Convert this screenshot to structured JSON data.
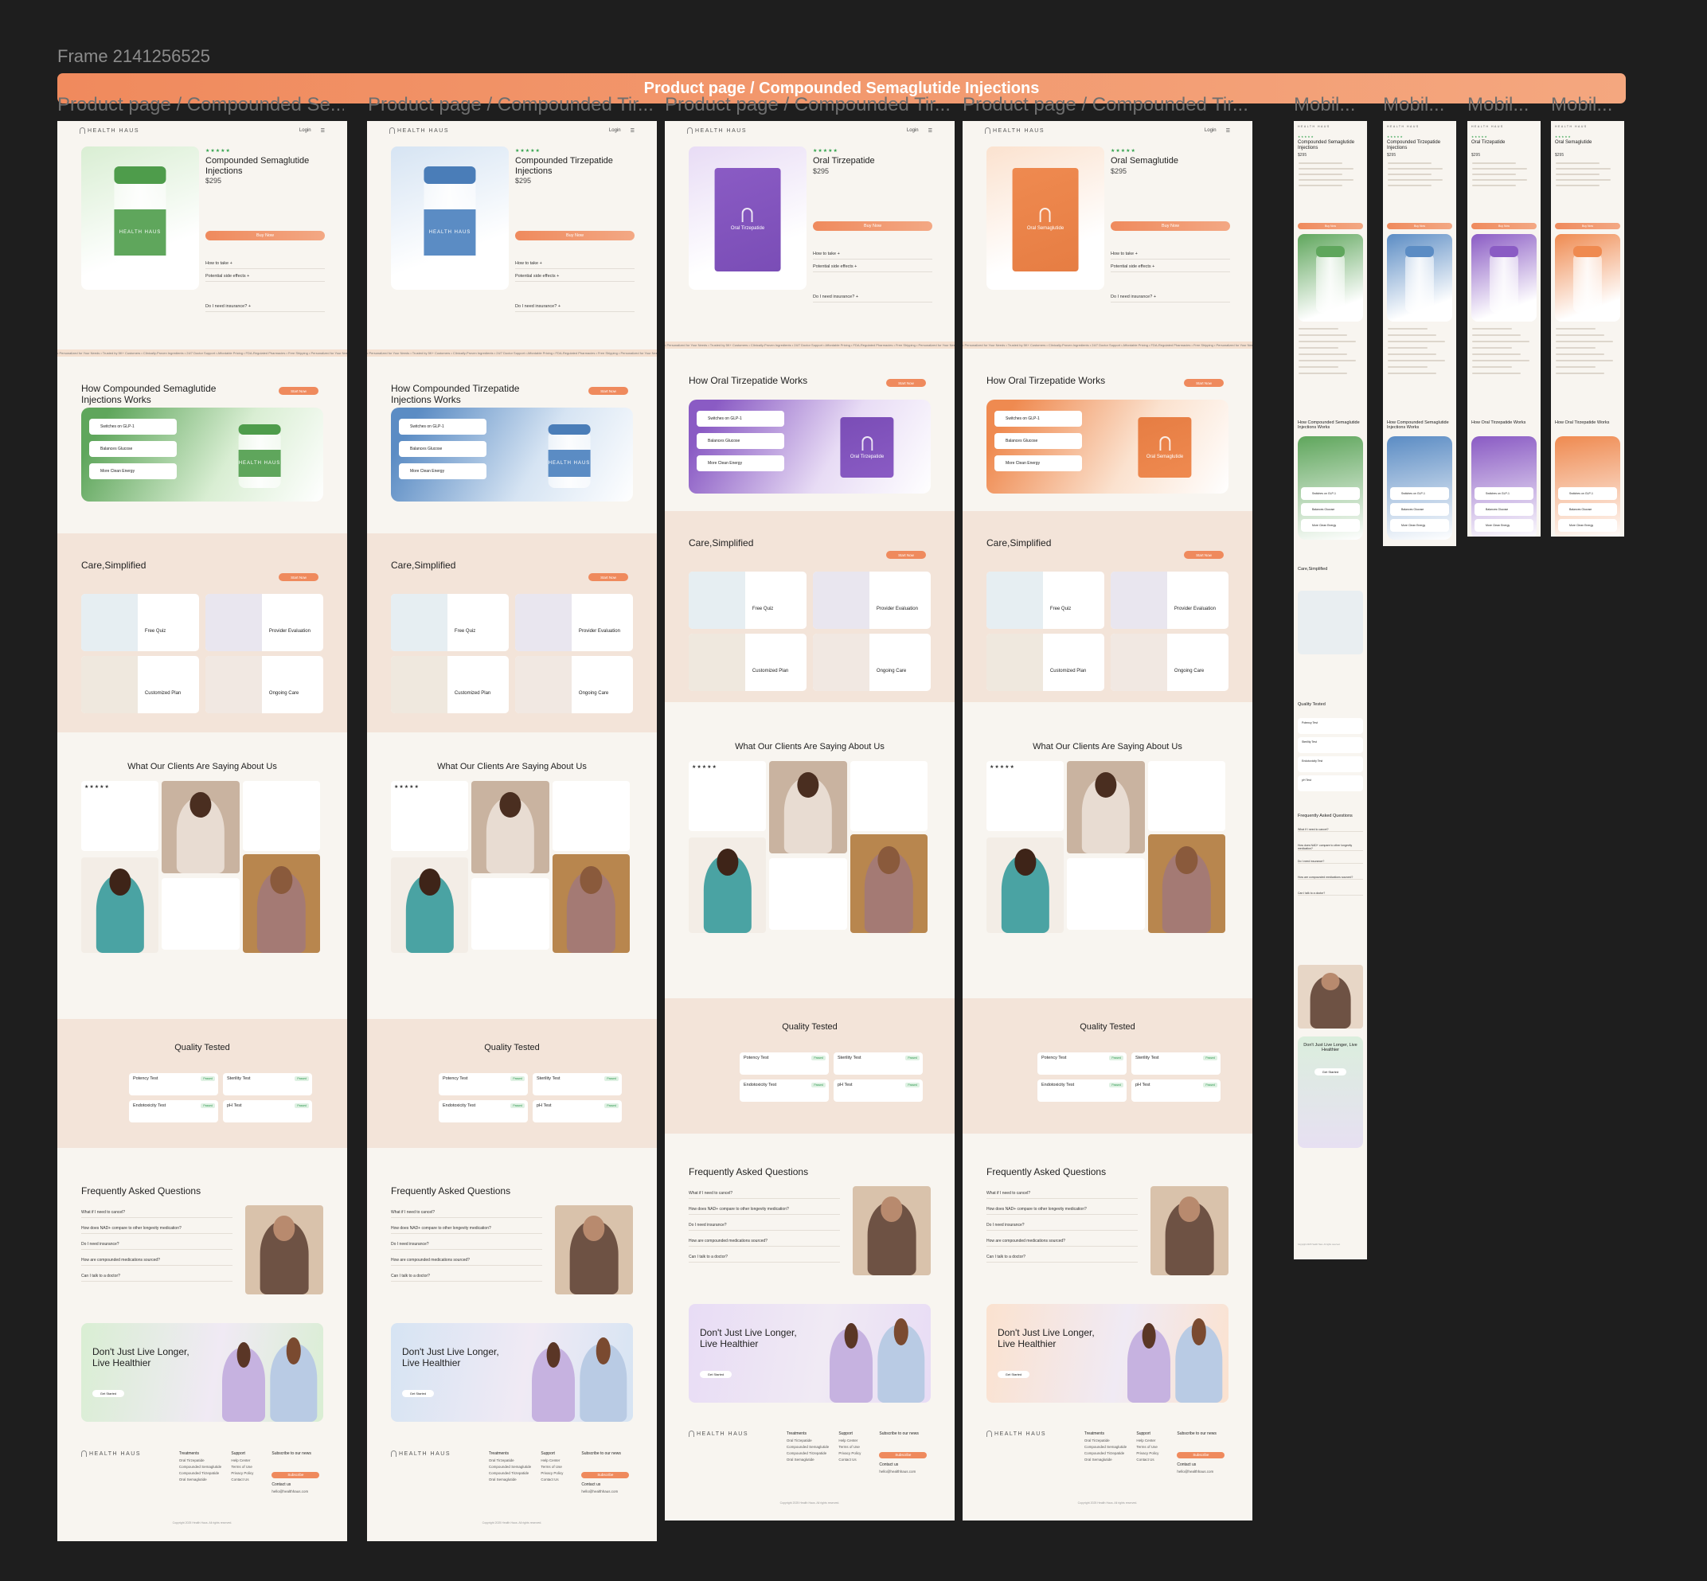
{
  "frame_title": "Frame 2141256525",
  "banner_title": "Product page / Compounded Semaglutide Injections",
  "brand": "HEALTH HAUS",
  "nav_login": "Login",
  "frame_labels": [
    "Product page / Compounded Se...",
    "Product page / Compounded Tir...",
    "Product page / Compounded Tir...",
    "Product page / Compounded Tir...",
    "Mobil...",
    "Mobil...",
    "Mobil...",
    "Mobil..."
  ],
  "price": "$295",
  "buy_label": "Buy Now",
  "stars": "★★★★★",
  "accordion": [
    "How to take",
    "Potential side effects",
    "Do I need insurance?"
  ],
  "how_items": [
    "Switches on GLP-1",
    "Balances Glucose",
    "More Clean Energy"
  ],
  "care_title": "Care,Simplified",
  "care_cards": [
    "Free Quiz",
    "Provider Evaluation",
    "Customized Plan",
    "Ongoing Care"
  ],
  "testimonials_title": "What Our Clients Are Saying About Us",
  "quality_title": "Quality Tested",
  "quality_tests": [
    "Potency Test",
    "Sterility Test",
    "Endotoxicity Test",
    "pH Test"
  ],
  "faq_title": "Frequently Asked Questions",
  "faq_items": [
    "What if I need to cancel?",
    "How does NAD+ compare to other longevity medication?",
    "Do I need insurance?",
    "How are compounded medications sourced?",
    "Can I talk to a doctor?"
  ],
  "cta_title": "Don't Just Live Longer, Live Healthier",
  "cta_button": "Get Started",
  "footer": {
    "treatments_title": "Treatments",
    "treatments": [
      "Oral Tirzepatide",
      "Compounded Semaglutide",
      "Compounded Tirzepatide",
      "Oral Semaglutide"
    ],
    "support_title": "Support",
    "support": [
      "Help Center",
      "Terms of Use",
      "Privacy Policy",
      "Contact Us"
    ],
    "subscribe_title": "Subscribe to our news",
    "subscribe_button": "Subscribe",
    "contact_title": "Contact us",
    "email": "hello@healthhaus.com",
    "copyright": "Copyright 2025 Health Haus. All rights reserved."
  },
  "ticker": "• Personalized for Your Needs  • Trusted by 5K+ Customers  • Clinically-Proven Ingredients  • 24/7 Doctor Support  • Affordable Pricing  • FDA-Regulated Pharmacies  • Free Shipping  • Personalized for Your Needs  • Trusted by 5K+ Customers  • Clinically-Proven Ingredients  • 24/7 Doctor Support",
  "desktop_pages": [
    {
      "name": "Compounded Semaglutide Injections",
      "how_title": "How Compounded Semaglutide Injections Works",
      "product_kind": "vial",
      "accent": "#5fa65c",
      "accent_light": "#d9eed3",
      "cap": "#4e9c4b",
      "label": "HEALTH HAUS"
    },
    {
      "name": "Compounded Tirzepatide Injections",
      "how_title": "How Compounded Tirzepatide Injections Works",
      "product_kind": "vial",
      "accent": "#5b8cc4",
      "accent_light": "#d6e4f3",
      "cap": "#4a7db8",
      "label": "HEALTH HAUS"
    },
    {
      "name": "Oral Tirzepatide",
      "how_title": "How Oral Tirzepatide Works",
      "product_kind": "pouch",
      "accent": "#8a5bc4",
      "accent_light": "#e8dcf5",
      "cap": "#7a4db6",
      "label": "Oral Tirzepatide"
    },
    {
      "name": "Oral Semaglutide",
      "how_title": "How Oral Tirzepatide Works",
      "product_kind": "pouch",
      "accent": "#ef8a50",
      "accent_light": "#fbe2cf",
      "cap": "#e67d43",
      "label": "Oral Semaglutide"
    }
  ],
  "mobile_pages": [
    {
      "name": "Compounded Semaglutide Injections",
      "accent": "#5fa65c",
      "how_title": "How Compounded Semaglutide Injections Works"
    },
    {
      "name": "Compounded Tirzepatide Injections",
      "accent": "#5b8cc4",
      "how_title": "How Compounded Semaglutide Injections Works"
    },
    {
      "name": "Oral Tirzepatide",
      "accent": "#8a5bc4",
      "how_title": "How Oral Tirzepatide Works"
    },
    {
      "name": "Oral Semaglutide",
      "accent": "#ef8a50",
      "how_title": "How Oral Tirzepatide Works"
    }
  ]
}
